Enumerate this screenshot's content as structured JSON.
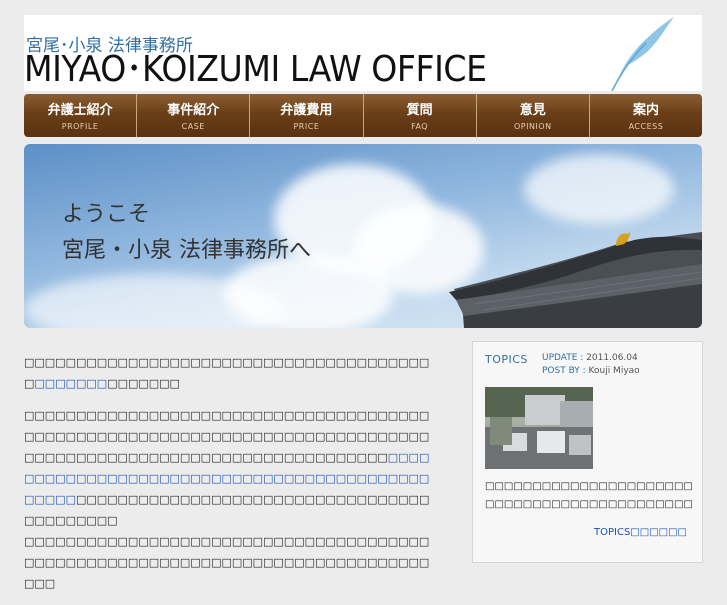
{
  "header": {
    "logo_jp": "宮尾･小泉 法律事務所",
    "logo_en": "MIYAO･KOIZUMI LAW OFFICE"
  },
  "nav": [
    {
      "label": "弁護士紹介",
      "sub": "PROFILE"
    },
    {
      "label": "事件紹介",
      "sub": "CASE"
    },
    {
      "label": "弁護費用",
      "sub": "PRICE"
    },
    {
      "label": "質問",
      "sub": "FAQ"
    },
    {
      "label": "意見",
      "sub": "OPINION"
    },
    {
      "label": "案内",
      "sub": "ACCESS"
    }
  ],
  "hero": {
    "line1": "ようこそ",
    "line2": "宮尾・小泉 法律事務所へ"
  },
  "main": {
    "p1_a": "□□□□□□□□□□□□□□□□□□□□□□□□□□□□□□□□□□□□□□□□",
    "p1_link": "□□□□□□□",
    "p1_b": "□□□□□□□",
    "p2_a": "□□□□□□□□□□□□□□□□□□□□□□□□□□□□□□□□□□□□□□□□□□□□□□□□□□□□□□□□□□□□□□□□□□□□□□□□□□□□□□□□□□□□□□□□□□□□□□□□□□□□□□□□□□□□□□□□□",
    "p2_link": "□□□□□□□□□□□□□□□□□□□□□□□□□□□□□□□□□□□□□□□□□□□□□□□□",
    "p2_b": "□□□□□□□□□□□□□□□□□□□□□□□□□□□□□□□□□□□□□□□□□□□",
    "p3": "□□□□□□□□□□□□□□□□□□□□□□□□□□□□□□□□□□□□□□□□□□□□□□□□□□□□□□□□□□□□□□□□□□□□□□□□□□□□□□□□□"
  },
  "sidebar": {
    "title": "TOPICS",
    "update_label": "UPDATE :",
    "update_value": "2011.06.04",
    "postby_label": "POST BY :",
    "postby_value": "Kouji Miyao",
    "text": "□□□□□□□□□□□□□□□□□□□□□□□□□□□□□□□□□□□□□□□□□□□□",
    "link": "TOPICS□□□□□□"
  }
}
